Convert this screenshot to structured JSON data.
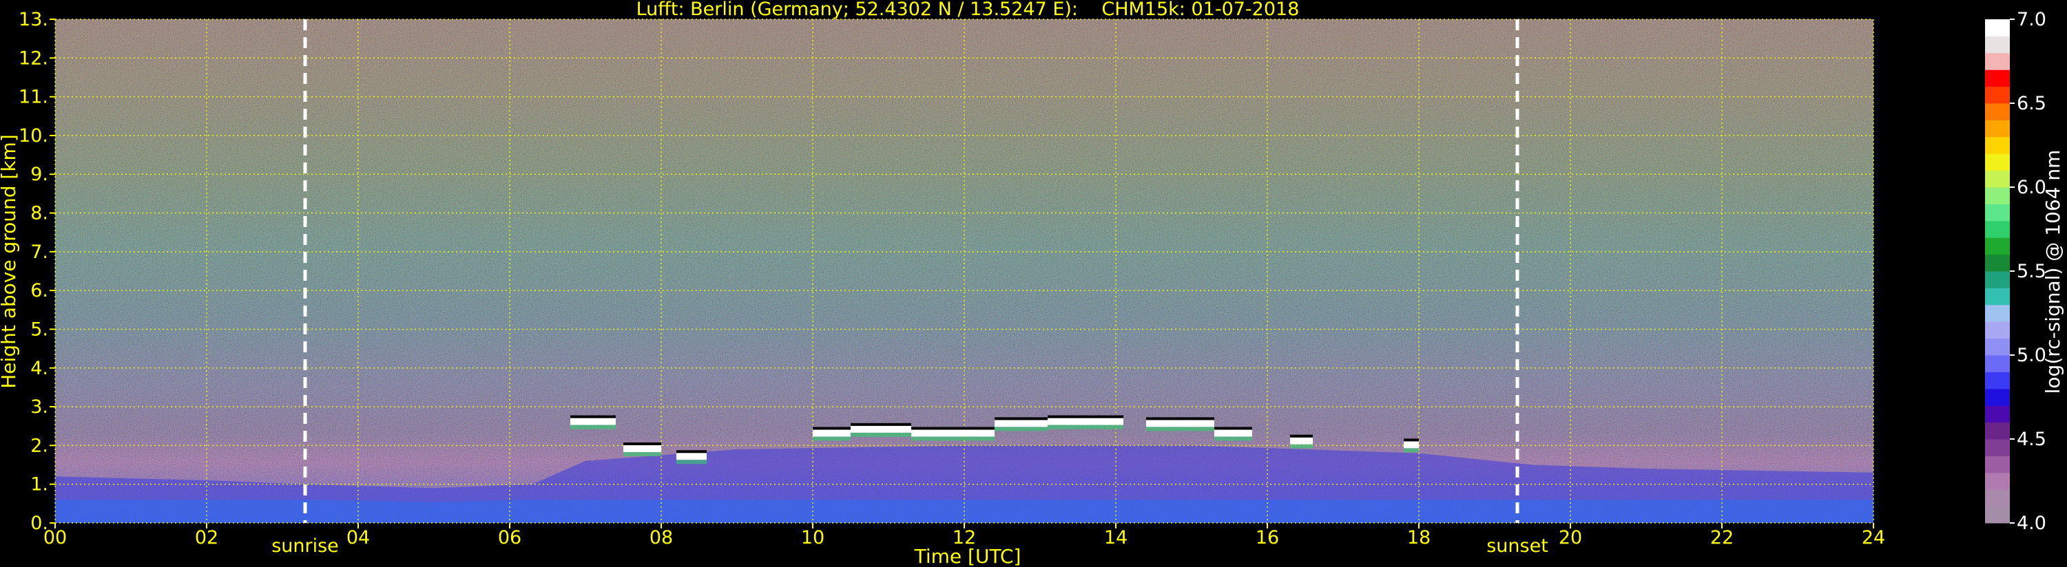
{
  "chart_data": {
    "type": "heatmap",
    "title": "Lufft: Berlin (Germany; 52.4302 N / 13.5247 E):    CHM15k: 01-07-2018",
    "xlabel": "Time [UTC]",
    "ylabel": "Height above ground [km]",
    "xlim": [
      0,
      24
    ],
    "ylim": [
      0,
      13
    ],
    "x_ticks": [
      0,
      2,
      4,
      6,
      8,
      10,
      12,
      14,
      16,
      18,
      20,
      22,
      24
    ],
    "x_tick_labels": [
      "00",
      "02",
      "04",
      "06",
      "08",
      "10",
      "12",
      "14",
      "16",
      "18",
      "20",
      "22",
      "24"
    ],
    "y_ticks": [
      0,
      1,
      2,
      3,
      4,
      5,
      6,
      7,
      8,
      9,
      10,
      11,
      12,
      13
    ],
    "y_tick_labels": [
      "0.",
      "1.",
      "2.",
      "3.",
      "4.",
      "5.",
      "6.",
      "7.",
      "8.",
      "9.",
      "10.",
      "11.",
      "12.",
      "13."
    ],
    "grid": true,
    "grid_color": "#ffff00",
    "markers": [
      {
        "label": "sunrise",
        "x": 3.3
      },
      {
        "label": "sunset",
        "x": 19.3
      }
    ],
    "colorbar": {
      "label": "log(rc-signal) @ 1064 nm",
      "range": [
        4.0,
        7.0
      ],
      "ticks": [
        4.0,
        4.5,
        5.0,
        5.5,
        6.0,
        6.5,
        7.0
      ],
      "tick_labels": [
        "4.0",
        "4.5",
        "5.0",
        "5.5",
        "6.0",
        "6.5",
        "7.0"
      ],
      "colors": [
        "#a58fa8",
        "#a98aac",
        "#b07cb0",
        "#9b5ea3",
        "#7f3f95",
        "#6a2588",
        "#4b0ab0",
        "#2010e0",
        "#3b3bf5",
        "#6b6bf7",
        "#8f8ff5",
        "#a8a8f2",
        "#9fc3f0",
        "#33c0b0",
        "#1fa37f",
        "#178a35",
        "#1ea92f",
        "#2fd06b",
        "#5ee68a",
        "#8ff07a",
        "#c6f252",
        "#f2f21a",
        "#ffd400",
        "#ffa500",
        "#ff7a00",
        "#ff3c00",
        "#ff0000",
        "#f4b4b4",
        "#e8e2e2",
        "#ffffff"
      ]
    },
    "cloud_layers": [
      {
        "t_start": 6.8,
        "t_end": 7.4,
        "height_km": 2.6
      },
      {
        "t_start": 7.5,
        "t_end": 8.0,
        "height_km": 1.9
      },
      {
        "t_start": 8.2,
        "t_end": 8.6,
        "height_km": 1.7
      },
      {
        "t_start": 10.0,
        "t_end": 10.5,
        "height_km": 2.3
      },
      {
        "t_start": 10.5,
        "t_end": 11.3,
        "height_km": 2.4
      },
      {
        "t_start": 11.3,
        "t_end": 12.4,
        "height_km": 2.3
      },
      {
        "t_start": 12.4,
        "t_end": 13.1,
        "height_km": 2.55
      },
      {
        "t_start": 13.1,
        "t_end": 14.1,
        "height_km": 2.6
      },
      {
        "t_start": 14.4,
        "t_end": 15.3,
        "height_km": 2.55
      },
      {
        "t_start": 15.3,
        "t_end": 15.8,
        "height_km": 2.3
      },
      {
        "t_start": 16.3,
        "t_end": 16.6,
        "height_km": 2.1
      },
      {
        "t_start": 17.8,
        "t_end": 18.0,
        "height_km": 2.0
      }
    ],
    "boundary_layer_height_km": [
      {
        "t": 0,
        "h": 1.2
      },
      {
        "t": 2,
        "h": 1.1
      },
      {
        "t": 3.3,
        "h": 1.0
      },
      {
        "t": 5,
        "h": 0.9
      },
      {
        "t": 6.3,
        "h": 1.0
      },
      {
        "t": 7,
        "h": 1.6
      },
      {
        "t": 9,
        "h": 1.9
      },
      {
        "t": 12,
        "h": 2.0
      },
      {
        "t": 15,
        "h": 2.0
      },
      {
        "t": 18,
        "h": 1.8
      },
      {
        "t": 19.5,
        "h": 1.5
      },
      {
        "t": 21,
        "h": 1.4
      },
      {
        "t": 24,
        "h": 1.3
      }
    ]
  }
}
